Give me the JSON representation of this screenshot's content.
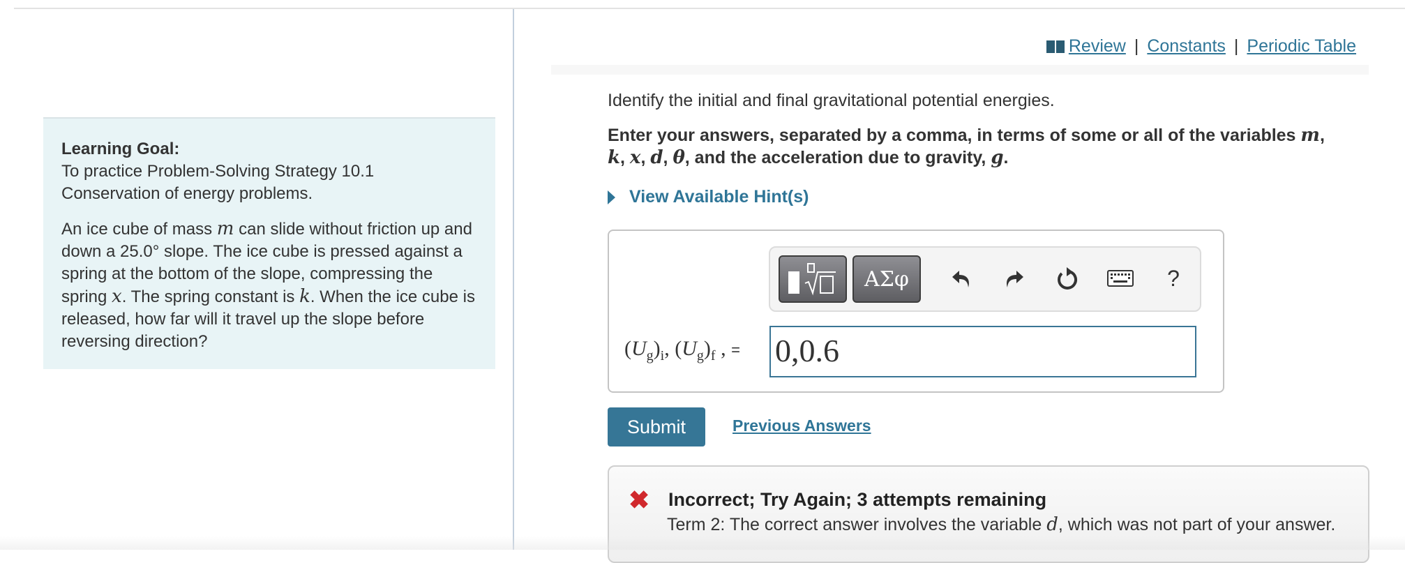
{
  "header_links": {
    "review": "Review",
    "constants": "Constants",
    "periodic_table": "Periodic Table",
    "separator": "|"
  },
  "learning_goal": {
    "title": "Learning Goal:",
    "text": "To practice Problem-Solving Strategy 10.1 Conservation of energy problems.",
    "problem_parts": {
      "p1": "An ice cube of mass ",
      "var_m": "m",
      "p2": " can slide without friction up and down a 25.0° slope. The ice cube is pressed against a spring at the bottom of the slope, compressing the spring ",
      "var_x": "x",
      "p3": ". The spring constant is ",
      "var_k": "k",
      "p4": ". When the ice cube is released, how far will it travel up the slope before reversing direction?"
    }
  },
  "question": {
    "prompt": "Identify the initial and final gravitational potential energies.",
    "instructions_parts": {
      "a": "Enter your answers, separated by a comma, in terms of some or all of the variables ",
      "m": "m",
      "b": ", ",
      "k": "k",
      "c": ", ",
      "x": "x",
      "d1": ", ",
      "d": "d",
      "e": ", ",
      "theta": "θ",
      "f": ", and the acceleration due to gravity, ",
      "g": "g",
      "h": "."
    },
    "hint_label": "View Available Hint(s)"
  },
  "toolbar": {
    "templates_icon": "templates-sqrt-icon",
    "symbols_label": "ΑΣφ",
    "undo_icon": "undo-icon",
    "redo_icon": "redo-icon",
    "reset_icon": "reset-icon",
    "keyboard_icon": "keyboard-icon",
    "help_label": "?"
  },
  "answer": {
    "label_U": "U",
    "label_g": "g",
    "label_i": "i",
    "label_f": "f",
    "label_eq": "=",
    "value": "0,0.6"
  },
  "actions": {
    "submit_label": "Submit",
    "previous_answers_label": "Previous Answers"
  },
  "feedback": {
    "icon": "✖",
    "title": "Incorrect; Try Again; 3 attempts remaining",
    "detail_a": "Term 2: The correct answer involves the variable ",
    "detail_var": "d",
    "detail_b": ", which was not part of your answer."
  },
  "colors": {
    "link": "#2f7597",
    "submit_bg": "#367696",
    "incorrect": "#d0282c",
    "goal_bg": "#e8f4f6"
  }
}
